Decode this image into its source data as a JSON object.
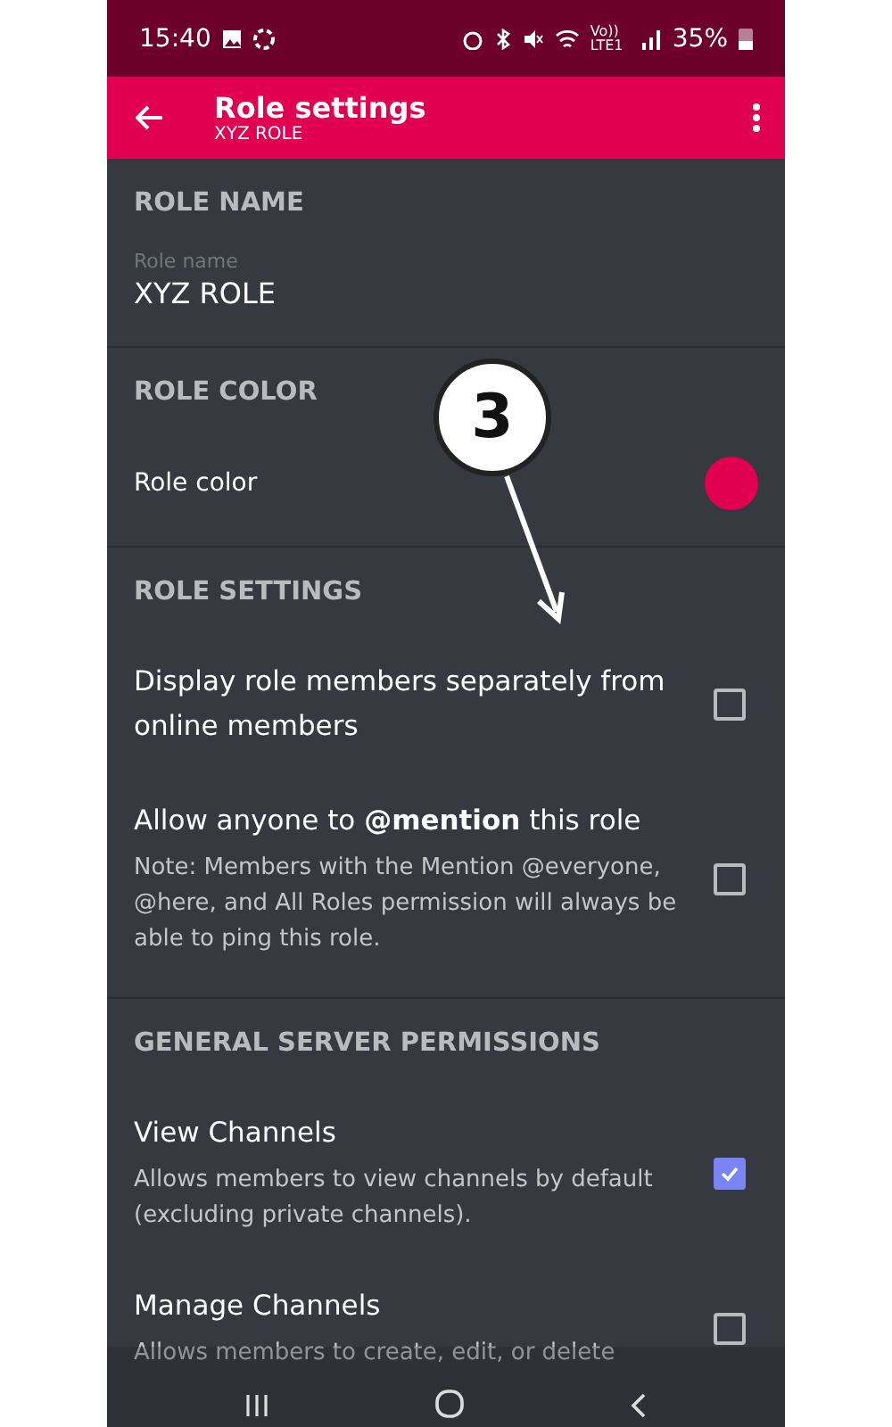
{
  "status_bar": {
    "time": "15:40",
    "network": "Vo)) LTE1",
    "battery": "35%"
  },
  "header": {
    "title": "Role settings",
    "subtitle": "XYZ ROLE"
  },
  "sections": [
    {
      "title": "ROLE NAME",
      "rows": [
        {
          "kind": "field",
          "label": "Role name",
          "value": "XYZ ROLE"
        }
      ]
    },
    {
      "title": "ROLE COLOR",
      "rows": [
        {
          "kind": "color",
          "label": "Role color",
          "color": "#e0004f"
        }
      ]
    },
    {
      "title": "ROLE SETTINGS",
      "rows": [
        {
          "kind": "checkbox",
          "label": "Display role members separately from online members",
          "checked": false
        },
        {
          "kind": "checkbox",
          "label": "Allow anyone to **@mention** this role",
          "note": "Note: Members with the Mention @everyone, @here, and All Roles permission will always be able to ping this role.",
          "checked": false
        }
      ]
    },
    {
      "title": "GENERAL SERVER PERMISSIONS",
      "rows": [
        {
          "kind": "checkbox",
          "label": "View Channels",
          "note": "Allows members to view channels by default (excluding private channels).",
          "checked": true
        },
        {
          "kind": "checkbox",
          "label": "Manage Channels",
          "note": "Allows members to create, edit, or delete",
          "checked": false
        }
      ]
    }
  ],
  "annotation": {
    "label": "3"
  }
}
